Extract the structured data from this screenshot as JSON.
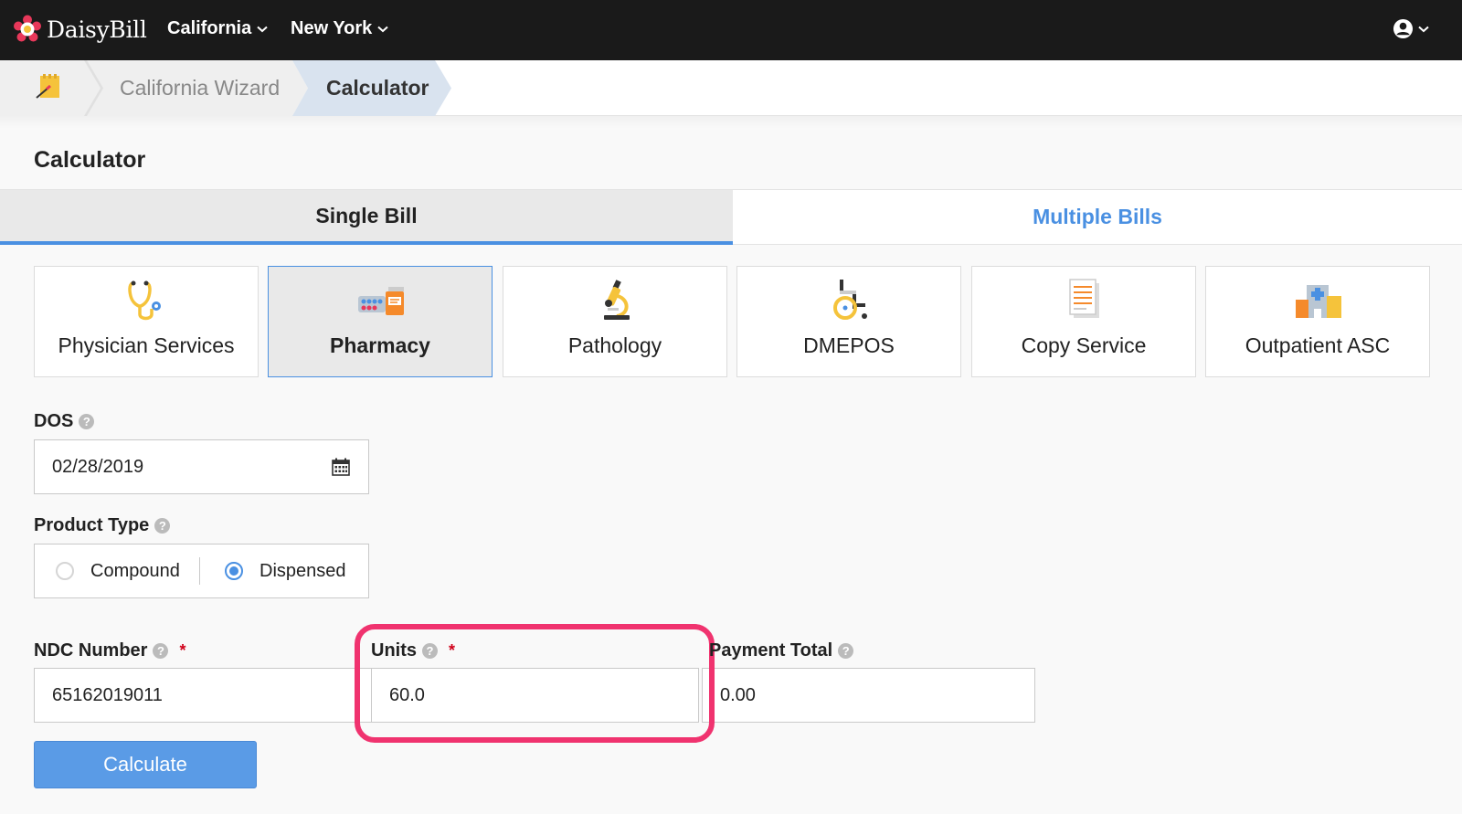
{
  "app": {
    "brand": "DaisyBill",
    "accent": "#4a90e2",
    "highlight": "#f0336f"
  },
  "nav": {
    "states": [
      "California",
      "New York"
    ],
    "user_icon": "user-circle-icon"
  },
  "breadcrumb": {
    "items": [
      "California Wizard",
      "Calculator"
    ],
    "home_icon": "notepad-icon"
  },
  "page": {
    "title": "Calculator"
  },
  "tabs": [
    {
      "label": "Single Bill",
      "active": true
    },
    {
      "label": "Multiple Bills",
      "active": false
    }
  ],
  "categories": [
    {
      "label": "Physician Services",
      "icon": "stethoscope-icon"
    },
    {
      "label": "Pharmacy",
      "icon": "pharmacy-icon",
      "active": true
    },
    {
      "label": "Pathology",
      "icon": "microscope-icon"
    },
    {
      "label": "DMEPOS",
      "icon": "wheelchair-icon"
    },
    {
      "label": "Copy Service",
      "icon": "document-icon"
    },
    {
      "label": "Outpatient ASC",
      "icon": "hospital-icon"
    }
  ],
  "form": {
    "dos": {
      "label": "DOS",
      "value": "02/28/2019"
    },
    "product_type": {
      "label": "Product Type",
      "options": [
        "Compound",
        "Dispensed"
      ],
      "selected": "Dispensed"
    },
    "ndc": {
      "label": "NDC Number",
      "value": "65162019011",
      "required_mark": "*"
    },
    "units": {
      "label": "Units",
      "value": "60.0",
      "required_mark": "*"
    },
    "payment_total": {
      "label": "Payment Total",
      "value": "0.00"
    },
    "submit_label": "Calculate"
  }
}
